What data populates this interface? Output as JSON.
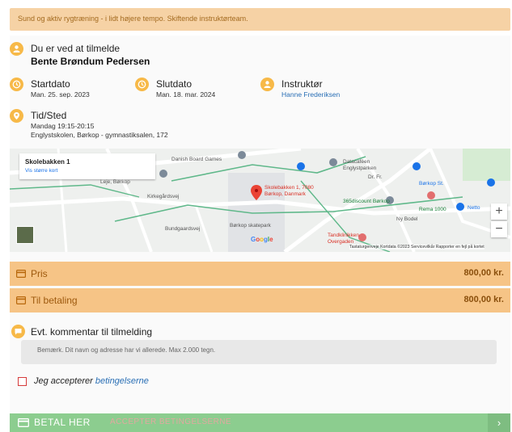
{
  "banner": {
    "text": "Sund og aktiv rygtræning - i lidt højere tempo. Skiftende instruktørteam."
  },
  "signup": {
    "label": "Du er ved at tilmelde",
    "name": "Bente Brøndum Pedersen"
  },
  "start": {
    "label": "Startdato",
    "value": "Man. 25. sep. 2023"
  },
  "end": {
    "label": "Slutdato",
    "value": "Man. 18. mar. 2024"
  },
  "instructor": {
    "label": "Instruktør",
    "value": "Hanne Frederiksen"
  },
  "place": {
    "label": "Tid/Sted",
    "time": "Mandag 19:15-20:15",
    "address": "Englystskolen, Børkop - gymnastiksalen, 172"
  },
  "map": {
    "card_title": "Skolebakken 1",
    "card_link": "Vis større kort",
    "pin_label_1": "Skolebakken 1, 7080",
    "pin_label_2": "Børkop, Danmark",
    "labels": {
      "danish_board_games": "Danish Board Games",
      "leje_borkop": "Leje, Børkop",
      "datacafeen": "Datacaféen",
      "englystparken": "Englystparken",
      "borkop_st": "Børkop St.",
      "discount": "365discount Børkop",
      "rema": "Rema 1000",
      "netto": "Netto",
      "skatepark": "Børkop skatepark",
      "tandklinikken_1": "Tandklinikken",
      "tandklinikken_2": "Overgaden",
      "bundgaardsvej": "Bundgaardsvej",
      "kirkegaardsvej": "Kirkegårdsvej",
      "ny_bodel": "Ny Bodel",
      "dr_fr": "Dr. Fr."
    },
    "google": "Google",
    "attribution": "Tastaturgenveje   Kortdata ©2023   Servicevilkår   Rapporter en fejl på kortet",
    "zoom_in": "+",
    "zoom_out": "−"
  },
  "price": {
    "label": "Pris",
    "value": "800,00 kr."
  },
  "to_pay": {
    "label": "Til betaling",
    "value": "800,00 kr."
  },
  "comment": {
    "label": "Evt. kommentar til tilmelding",
    "placeholder": "Bemærk. Dit navn og adresse har vi allerede. Max 2.000 tegn."
  },
  "terms": {
    "prefix": "Jeg accepterer",
    "link": "betingelserne"
  },
  "pay": {
    "label": "BETAL HER",
    "hint": "ACCEPTER BETINGELSERNE",
    "arrow": "›"
  },
  "colors": {
    "accent": "#f7b948",
    "price_bar": "#f6c486",
    "pay_button": "#8ccd8f",
    "link": "#2a6fb5"
  }
}
